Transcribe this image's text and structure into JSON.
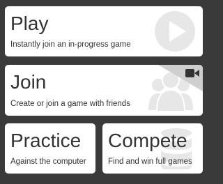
{
  "cards": {
    "play": {
      "title": "Play",
      "description": "Instantly join an in-progress game",
      "icon": "play-circle-icon"
    },
    "join": {
      "title": "Join",
      "description": "Create or join a game with friends",
      "icon": "users-group-icon",
      "badge_icon": "video-camera-icon"
    },
    "practice": {
      "title": "Practice",
      "description": "Against the computer"
    },
    "compete": {
      "title": "Compete",
      "description": "Find and win full games",
      "icon": "database-stack-icon"
    }
  },
  "colors": {
    "background": "#3a3a3a",
    "card": "#ffffff",
    "text": "#333333",
    "icon_faint": "#e7e7e7",
    "corner": "#cfcfcf"
  }
}
